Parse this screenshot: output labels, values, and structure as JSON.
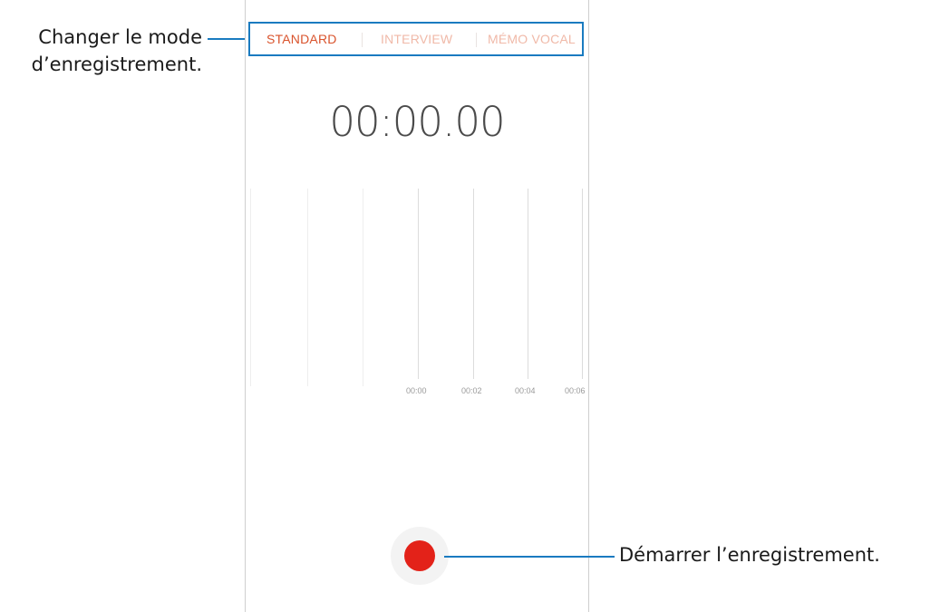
{
  "recorder": {
    "modes": [
      {
        "label": "STANDARD",
        "active": true
      },
      {
        "label": "INTERVIEW",
        "active": false
      },
      {
        "label": "MÉMO VOCAL",
        "active": false
      }
    ],
    "timer": "00:00.00",
    "timeline_ticks": [
      "00:00",
      "00:02",
      "00:04",
      "00:06"
    ],
    "record_button_color": "#e32219"
  },
  "annotations": {
    "mode_line1": "Changer le mode",
    "mode_line2": "d’enregistrement.",
    "record": "Démarrer l’enregistrement."
  },
  "colors": {
    "accent_active": "#d9532c",
    "accent_inactive": "#f0b9a8",
    "callout_line": "#1a7bc0"
  }
}
